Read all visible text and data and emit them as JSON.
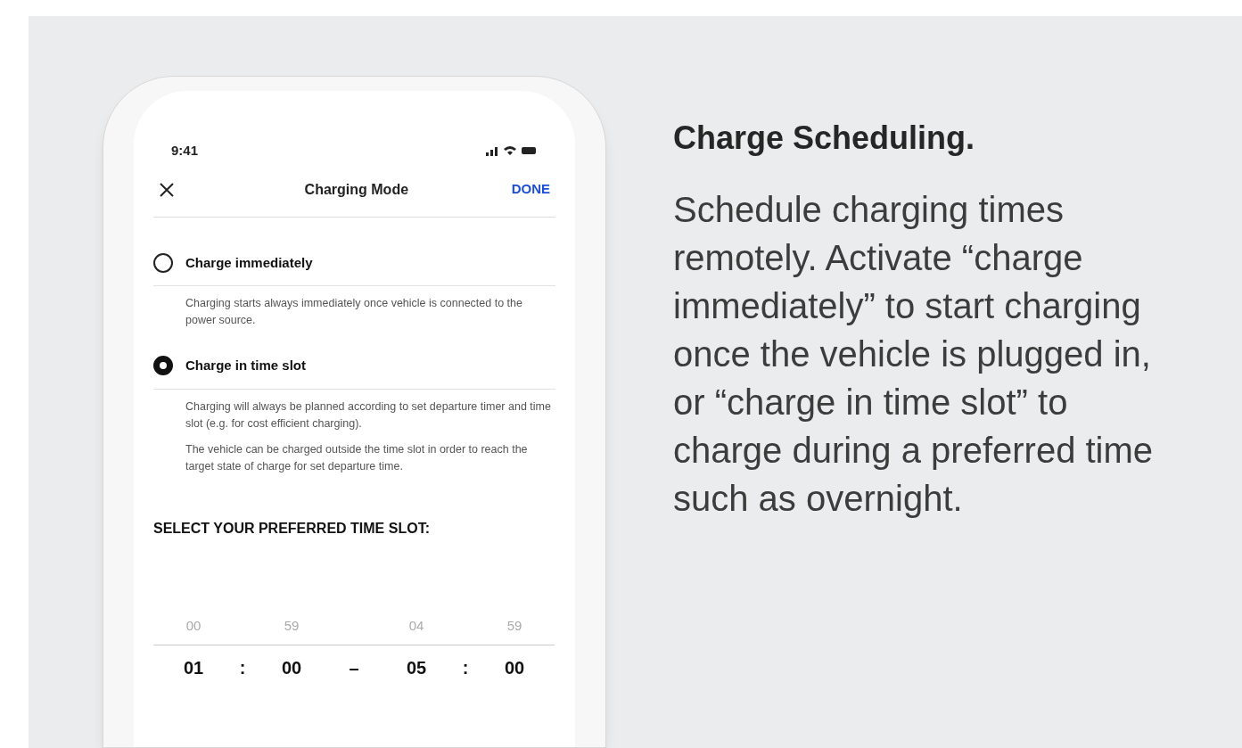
{
  "phone": {
    "status_bar": {
      "time": "9:41"
    },
    "header": {
      "title": "Charging Mode",
      "action": "DONE"
    },
    "options": [
      {
        "title": "Charge immediately",
        "selected": false,
        "descriptions": [
          "Charging starts always immediately once vehicle is connected to the power source."
        ]
      },
      {
        "title": "Charge in time slot",
        "selected": true,
        "descriptions": [
          "Charging will always be planned according to set departure timer and time slot (e.g. for cost efficient charging).",
          "The vehicle can be charged outside the time slot in order to reach the target state of charge for set departure time."
        ]
      }
    ],
    "section_heading": "SELECT YOUR PREFERRED TIME SLOT:",
    "time_picker": {
      "slots": [
        {
          "hour_previous": "00",
          "hour": "01",
          "colon": ":",
          "minute_previous": "59",
          "minute": "00"
        },
        {
          "hour_previous": "04",
          "hour": "05",
          "colon": ":",
          "minute_previous": "59",
          "minute": "00"
        }
      ],
      "range_separator": "–"
    }
  },
  "feature": {
    "heading": "Charge Scheduling.",
    "body": "Schedule charging times remotely. Activate “charge immediately” to start charging once the vehicle is plugged in, or “charge in time slot” to charge during a preferred time such as overnight."
  }
}
